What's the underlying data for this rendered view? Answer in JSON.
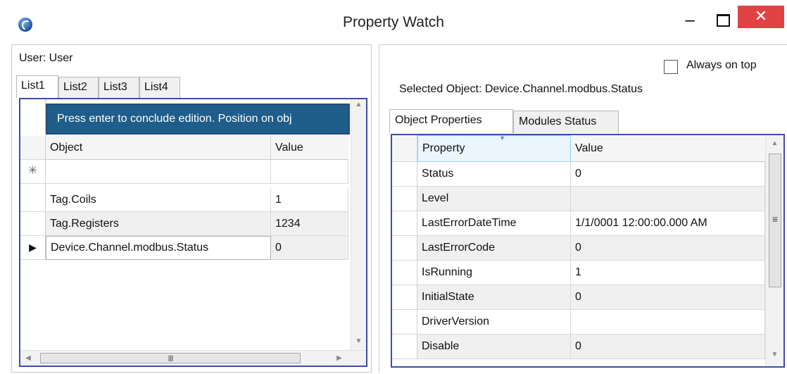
{
  "window": {
    "title": "Property Watch",
    "minimize_glyph": "–",
    "close_glyph": "✕",
    "icon": "app-globe-icon"
  },
  "left": {
    "user_label": "User: User",
    "tabs": [
      {
        "label": "List1",
        "active": true
      },
      {
        "label": "List2",
        "active": false
      },
      {
        "label": "List3",
        "active": false
      },
      {
        "label": "List4",
        "active": false
      }
    ],
    "banner": "Press enter to conclude edition. Position on obj",
    "columns": [
      "Object",
      "Value"
    ],
    "new_row_marker": "✳",
    "current_row_marker": "▶",
    "rows": [
      {
        "object": "",
        "value": ""
      },
      {
        "object": "Tag.Coils",
        "value": "1"
      },
      {
        "object": "Tag.Registers",
        "value": "1234"
      },
      {
        "object": "Device.Channel.modbus.Status",
        "value": "0"
      }
    ],
    "hscroll_grip": "III"
  },
  "right": {
    "always_on_top_label": "Always on top",
    "always_on_top_checked": false,
    "selected_object_label": "Selected Object:  Device.Channel.modbus.Status",
    "tabs": [
      {
        "label": "Object Properties",
        "active": true
      },
      {
        "label": "Modules Status",
        "active": false
      }
    ],
    "columns": [
      "Property",
      "Value"
    ],
    "rows": [
      {
        "property": "Status",
        "value": "0"
      },
      {
        "property": "Level",
        "value": ""
      },
      {
        "property": "LastErrorDateTime",
        "value": "1/1/0001 12:00:00.000 AM"
      },
      {
        "property": "LastErrorCode",
        "value": "0"
      },
      {
        "property": "IsRunning",
        "value": "1"
      },
      {
        "property": "InitialState",
        "value": "0"
      },
      {
        "property": "DriverVersion",
        "value": ""
      },
      {
        "property": "Disable",
        "value": "0"
      }
    ],
    "scroll_grip": "≡"
  },
  "colors": {
    "grid_border": "#3c4ea8",
    "banner_bg": "#1f5d8a",
    "close_button": "#e04343"
  }
}
